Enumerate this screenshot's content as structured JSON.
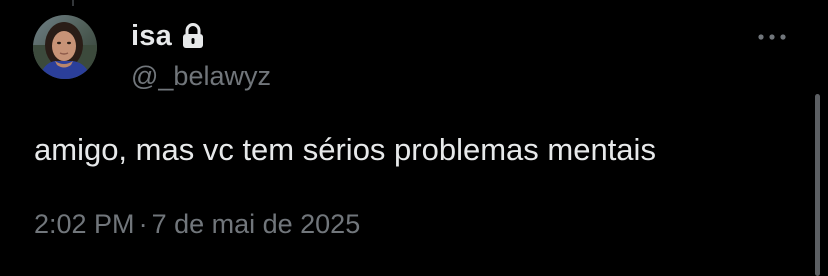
{
  "tweet": {
    "display_name": "isa",
    "handle": "@_belawyz",
    "text": "amigo, mas vc tem sérios problemas mentais",
    "time": "2:02 PM",
    "separator": "·",
    "date": "7 de mai de 2025",
    "protected_icon": "lock-icon",
    "more_icon": "more-horizontal-icon",
    "avatar": "avatar-photo"
  },
  "colors": {
    "background": "#000000",
    "primary_text": "#e7e9ea",
    "secondary_text": "#71767b"
  }
}
